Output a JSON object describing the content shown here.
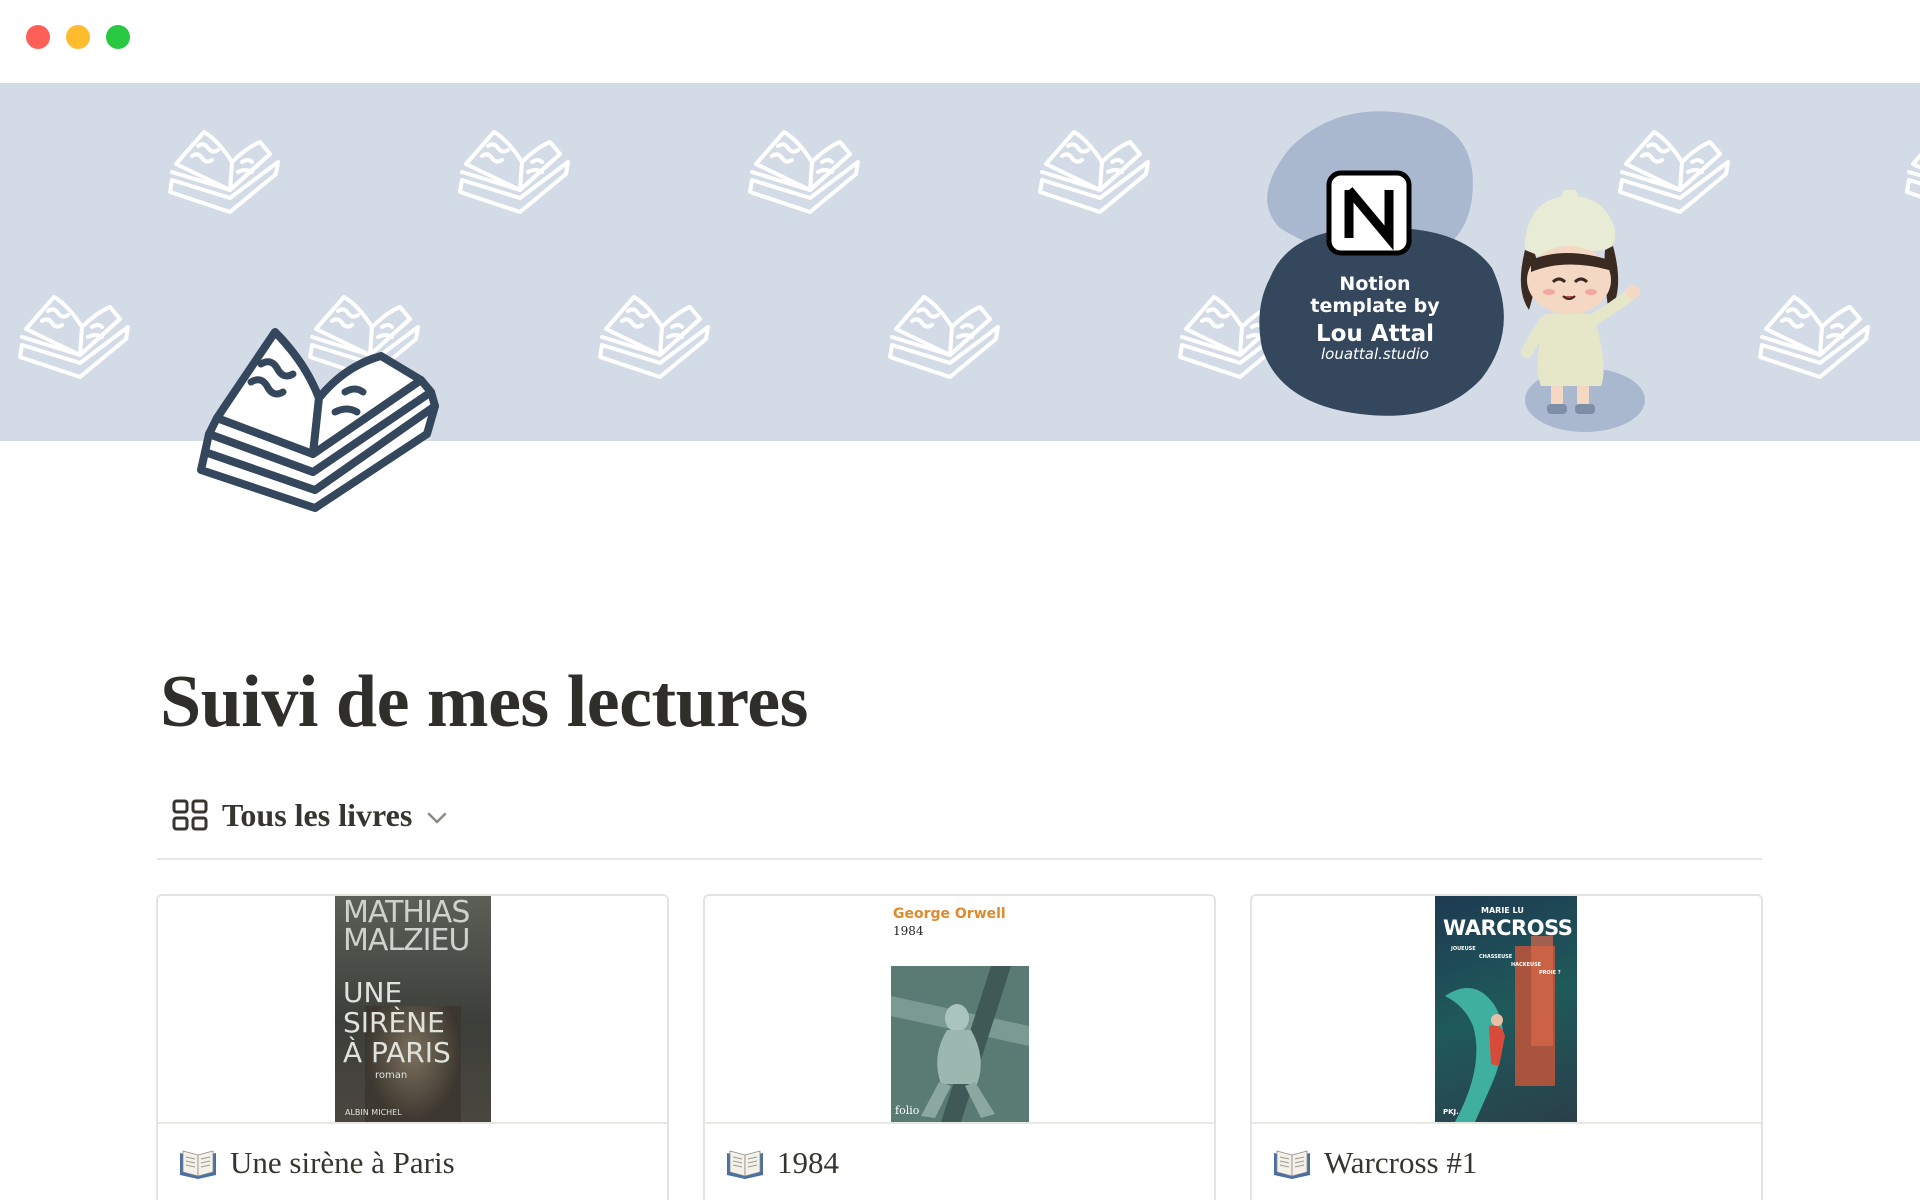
{
  "window": {
    "controls": [
      "close",
      "minimize",
      "maximize"
    ]
  },
  "cover": {
    "background_color": "#d3dce6",
    "pattern_icon": "open-book-icon",
    "badge": {
      "line1": "Notion",
      "line2": "template by",
      "line3": "Lou Attal",
      "line4": "louattal.studio"
    }
  },
  "page": {
    "icon": "open-book-icon",
    "title": "Suivi de mes lectures"
  },
  "view": {
    "icon": "gallery-grid-icon",
    "label": "Tous les livres"
  },
  "books": [
    {
      "title": "Une sirène à Paris",
      "emoji": "open-book-icon",
      "cover": {
        "author_line1": "MATHIAS",
        "author_line2": "MALZIEU",
        "title_line1": "UNE",
        "title_line2": "SIRÈNE",
        "title_line3": "À PARIS",
        "genre": "roman",
        "publisher": "ALBIN MICHEL"
      }
    },
    {
      "title": "1984",
      "emoji": "open-book-icon",
      "cover": {
        "author": "George Orwell",
        "title": "1984",
        "publisher": "folio"
      }
    },
    {
      "title": "Warcross #1",
      "emoji": "open-book-icon",
      "cover": {
        "author": "MARIE LU",
        "title": "WARCROSS",
        "tagline1": "JOUEUSE",
        "tagline2": "CHASSEUSE",
        "tagline3": "HACKEUSE",
        "tagline4": "PROIE ?",
        "publisher": "PKJ."
      }
    }
  ]
}
